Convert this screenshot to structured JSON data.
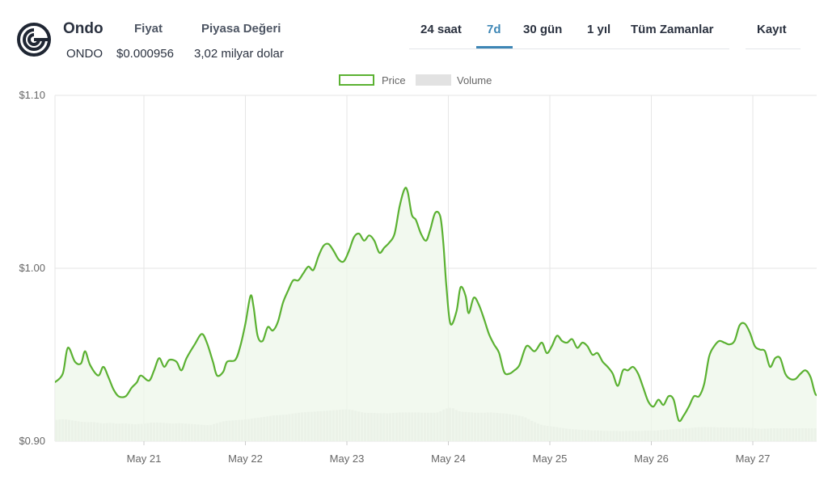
{
  "header": {
    "coin_name": "Ondo",
    "coin_symbol": "ONDO",
    "price_label": "Fiyat",
    "price_value": "$0.000956",
    "market_cap_label": "Piyasa Değeri",
    "market_cap_value": "3,02 milyar dolar",
    "logo_icon": "ondo-logo-icon"
  },
  "tabs": [
    {
      "label": "24 saat",
      "active": false
    },
    {
      "label": "7d",
      "active": true
    },
    {
      "label": "30 gün",
      "active": false
    },
    {
      "label": "1 yıl",
      "active": false
    },
    {
      "label": "Tüm Zamanlar",
      "active": false
    }
  ],
  "register_label": "Kayıt",
  "colors": {
    "accent": "#3d86b5",
    "price_line": "#5bb132",
    "price_fill": "#eef7e9",
    "volume_bar": "#e2e2e2",
    "grid": "#e6e6e6"
  },
  "chart_data": {
    "type": "line",
    "legend": [
      "Price",
      "Volume"
    ],
    "legend_position": "top-center",
    "grid": true,
    "y_ticks": [
      "$1.10",
      "$1.00",
      "$0.90"
    ],
    "ylim": [
      0.9,
      1.1
    ],
    "x_ticks": [
      "May 21",
      "May 22",
      "May 23",
      "May 24",
      "May 25",
      "May 26",
      "May 27"
    ],
    "x_tick_values": [
      1,
      2,
      3,
      4,
      5,
      6,
      7
    ],
    "xlim": [
      0.12,
      7.6
    ],
    "series": [
      {
        "name": "Price",
        "points": [
          [
            0.12,
            0.934
          ],
          [
            0.2,
            0.939
          ],
          [
            0.25,
            0.954
          ],
          [
            0.32,
            0.946
          ],
          [
            0.38,
            0.945
          ],
          [
            0.42,
            0.952
          ],
          [
            0.47,
            0.944
          ],
          [
            0.55,
            0.938
          ],
          [
            0.6,
            0.943
          ],
          [
            0.65,
            0.937
          ],
          [
            0.7,
            0.93
          ],
          [
            0.75,
            0.926
          ],
          [
            0.82,
            0.926
          ],
          [
            0.88,
            0.931
          ],
          [
            0.93,
            0.934
          ],
          [
            0.97,
            0.938
          ],
          [
            1.05,
            0.935
          ],
          [
            1.1,
            0.941
          ],
          [
            1.15,
            0.948
          ],
          [
            1.2,
            0.943
          ],
          [
            1.25,
            0.947
          ],
          [
            1.32,
            0.946
          ],
          [
            1.37,
            0.941
          ],
          [
            1.42,
            0.948
          ],
          [
            1.5,
            0.956
          ],
          [
            1.57,
            0.962
          ],
          [
            1.62,
            0.957
          ],
          [
            1.68,
            0.946
          ],
          [
            1.72,
            0.938
          ],
          [
            1.78,
            0.94
          ],
          [
            1.82,
            0.946
          ],
          [
            1.9,
            0.947
          ],
          [
            1.95,
            0.955
          ],
          [
            2.0,
            0.968
          ],
          [
            2.05,
            0.984
          ],
          [
            2.08,
            0.978
          ],
          [
            2.12,
            0.961
          ],
          [
            2.17,
            0.958
          ],
          [
            2.22,
            0.966
          ],
          [
            2.27,
            0.964
          ],
          [
            2.32,
            0.969
          ],
          [
            2.37,
            0.98
          ],
          [
            2.42,
            0.987
          ],
          [
            2.47,
            0.993
          ],
          [
            2.52,
            0.993
          ],
          [
            2.57,
            0.997
          ],
          [
            2.62,
            1.001
          ],
          [
            2.67,
            0.999
          ],
          [
            2.72,
            1.007
          ],
          [
            2.77,
            1.013
          ],
          [
            2.82,
            1.014
          ],
          [
            2.87,
            1.01
          ],
          [
            2.92,
            1.005
          ],
          [
            2.97,
            1.004
          ],
          [
            3.02,
            1.01
          ],
          [
            3.07,
            1.018
          ],
          [
            3.12,
            1.02
          ],
          [
            3.17,
            1.016
          ],
          [
            3.22,
            1.019
          ],
          [
            3.27,
            1.016
          ],
          [
            3.32,
            1.009
          ],
          [
            3.37,
            1.012
          ],
          [
            3.42,
            1.015
          ],
          [
            3.47,
            1.02
          ],
          [
            3.52,
            1.036
          ],
          [
            3.57,
            1.046
          ],
          [
            3.6,
            1.044
          ],
          [
            3.64,
            1.031
          ],
          [
            3.68,
            1.028
          ],
          [
            3.73,
            1.02
          ],
          [
            3.78,
            1.016
          ],
          [
            3.82,
            1.022
          ],
          [
            3.87,
            1.032
          ],
          [
            3.92,
            1.03
          ],
          [
            3.95,
            1.015
          ],
          [
            3.98,
            0.99
          ],
          [
            4.02,
            0.968
          ],
          [
            4.08,
            0.975
          ],
          [
            4.12,
            0.989
          ],
          [
            4.17,
            0.984
          ],
          [
            4.2,
            0.974
          ],
          [
            4.25,
            0.983
          ],
          [
            4.3,
            0.979
          ],
          [
            4.35,
            0.971
          ],
          [
            4.4,
            0.962
          ],
          [
            4.45,
            0.956
          ],
          [
            4.5,
            0.951
          ],
          [
            4.55,
            0.94
          ],
          [
            4.6,
            0.939
          ],
          [
            4.65,
            0.941
          ],
          [
            4.7,
            0.944
          ],
          [
            4.77,
            0.955
          ],
          [
            4.85,
            0.952
          ],
          [
            4.92,
            0.957
          ],
          [
            4.97,
            0.951
          ],
          [
            5.02,
            0.955
          ],
          [
            5.07,
            0.961
          ],
          [
            5.12,
            0.958
          ],
          [
            5.17,
            0.957
          ],
          [
            5.22,
            0.959
          ],
          [
            5.27,
            0.954
          ],
          [
            5.32,
            0.957
          ],
          [
            5.37,
            0.955
          ],
          [
            5.42,
            0.95
          ],
          [
            5.47,
            0.951
          ],
          [
            5.52,
            0.946
          ],
          [
            5.57,
            0.943
          ],
          [
            5.62,
            0.939
          ],
          [
            5.67,
            0.932
          ],
          [
            5.72,
            0.941
          ],
          [
            5.77,
            0.941
          ],
          [
            5.82,
            0.943
          ],
          [
            5.87,
            0.939
          ],
          [
            5.92,
            0.931
          ],
          [
            5.97,
            0.923
          ],
          [
            6.02,
            0.92
          ],
          [
            6.07,
            0.924
          ],
          [
            6.12,
            0.921
          ],
          [
            6.17,
            0.926
          ],
          [
            6.22,
            0.924
          ],
          [
            6.27,
            0.912
          ],
          [
            6.32,
            0.915
          ],
          [
            6.37,
            0.92
          ],
          [
            6.42,
            0.926
          ],
          [
            6.47,
            0.926
          ],
          [
            6.52,
            0.933
          ],
          [
            6.57,
            0.949
          ],
          [
            6.62,
            0.955
          ],
          [
            6.67,
            0.958
          ],
          [
            6.72,
            0.957
          ],
          [
            6.77,
            0.956
          ],
          [
            6.82,
            0.958
          ],
          [
            6.87,
            0.967
          ],
          [
            6.92,
            0.968
          ],
          [
            6.97,
            0.963
          ],
          [
            7.02,
            0.955
          ],
          [
            7.07,
            0.953
          ],
          [
            7.12,
            0.952
          ],
          [
            7.17,
            0.943
          ],
          [
            7.22,
            0.948
          ],
          [
            7.27,
            0.948
          ],
          [
            7.32,
            0.939
          ],
          [
            7.37,
            0.936
          ],
          [
            7.42,
            0.936
          ],
          [
            7.47,
            0.939
          ],
          [
            7.52,
            0.941
          ],
          [
            7.57,
            0.937
          ],
          [
            7.62,
            0.927
          ],
          [
            7.67,
            0.929
          ],
          [
            7.72,
            0.935
          ],
          [
            7.77,
            0.935
          ],
          [
            7.82,
            0.931
          ],
          [
            7.87,
            0.946
          ],
          [
            7.92,
            0.951
          ],
          [
            7.97,
            0.95
          ],
          [
            8.02,
            0.951
          ],
          [
            8.07,
            0.952
          ],
          [
            8.12,
            0.951
          ]
        ]
      },
      {
        "name": "Volume",
        "values": [
          0.94,
          0.96,
          0.97,
          0.96,
          0.94,
          0.92,
          0.9,
          0.88,
          0.86,
          0.85,
          0.84,
          0.85,
          0.84,
          0.82,
          0.8,
          0.79,
          0.8,
          0.81,
          0.8,
          0.78,
          0.78,
          0.79,
          0.79,
          0.77,
          0.76,
          0.75,
          0.76,
          0.77,
          0.78,
          0.8,
          0.82,
          0.82,
          0.83,
          0.82,
          0.81,
          0.8,
          0.79,
          0.78,
          0.79,
          0.8,
          0.79,
          0.78,
          0.77,
          0.76,
          0.75,
          0.74,
          0.73,
          0.72,
          0.71,
          0.72,
          0.76,
          0.8,
          0.84,
          0.88,
          0.9,
          0.91,
          0.92,
          0.93,
          0.94,
          0.95,
          0.96,
          0.98,
          1.0,
          1.02,
          1.04,
          1.06,
          1.08,
          1.1,
          1.12,
          1.14,
          1.15,
          1.16,
          1.17,
          1.18,
          1.2,
          1.22,
          1.24,
          1.26,
          1.27,
          1.28,
          1.29,
          1.3,
          1.31,
          1.32,
          1.33,
          1.34,
          1.35,
          1.36,
          1.37,
          1.38,
          1.39,
          1.4,
          1.41,
          1.4,
          1.38,
          1.35,
          1.31,
          1.28,
          1.26,
          1.25,
          1.25,
          1.25,
          1.24,
          1.24,
          1.24,
          1.23,
          1.24,
          1.25,
          1.26,
          1.27,
          1.27,
          1.27,
          1.27,
          1.27,
          1.27,
          1.27,
          1.26,
          1.26,
          1.26,
          1.26,
          1.26,
          1.27,
          1.32,
          1.4,
          1.45,
          1.48,
          1.46,
          1.38,
          1.32,
          1.3,
          1.29,
          1.28,
          1.27,
          1.26,
          1.26,
          1.26,
          1.26,
          1.27,
          1.27,
          1.26,
          1.25,
          1.24,
          1.23,
          1.22,
          1.2,
          1.18,
          1.16,
          1.13,
          1.1,
          1.05,
          0.98,
          0.9,
          0.84,
          0.78,
          0.73,
          0.7,
          0.68,
          0.66,
          0.64,
          0.62,
          0.6,
          0.58,
          0.56,
          0.54,
          0.53,
          0.52,
          0.51,
          0.5,
          0.49,
          0.49,
          0.48,
          0.48,
          0.48,
          0.47,
          0.46,
          0.46,
          0.46,
          0.46,
          0.46,
          0.45,
          0.45,
          0.46,
          0.46,
          0.46,
          0.46,
          0.46,
          0.46,
          0.47,
          0.47,
          0.47,
          0.47,
          0.48,
          0.49,
          0.5,
          0.51,
          0.52,
          0.53,
          0.54,
          0.55,
          0.56,
          0.57,
          0.58,
          0.59,
          0.61,
          0.62,
          0.62,
          0.62,
          0.62,
          0.62,
          0.62,
          0.61,
          0.61,
          0.61,
          0.61,
          0.61,
          0.6,
          0.6,
          0.6,
          0.6,
          0.59,
          0.59,
          0.58,
          0.57,
          0.56,
          0.55,
          0.56,
          0.56,
          0.57,
          0.57,
          0.57,
          0.57,
          0.57,
          0.57,
          0.57,
          0.57,
          0.57,
          0.57,
          0.57,
          0.57,
          0.57,
          0.57,
          0.57
        ]
      }
    ]
  }
}
